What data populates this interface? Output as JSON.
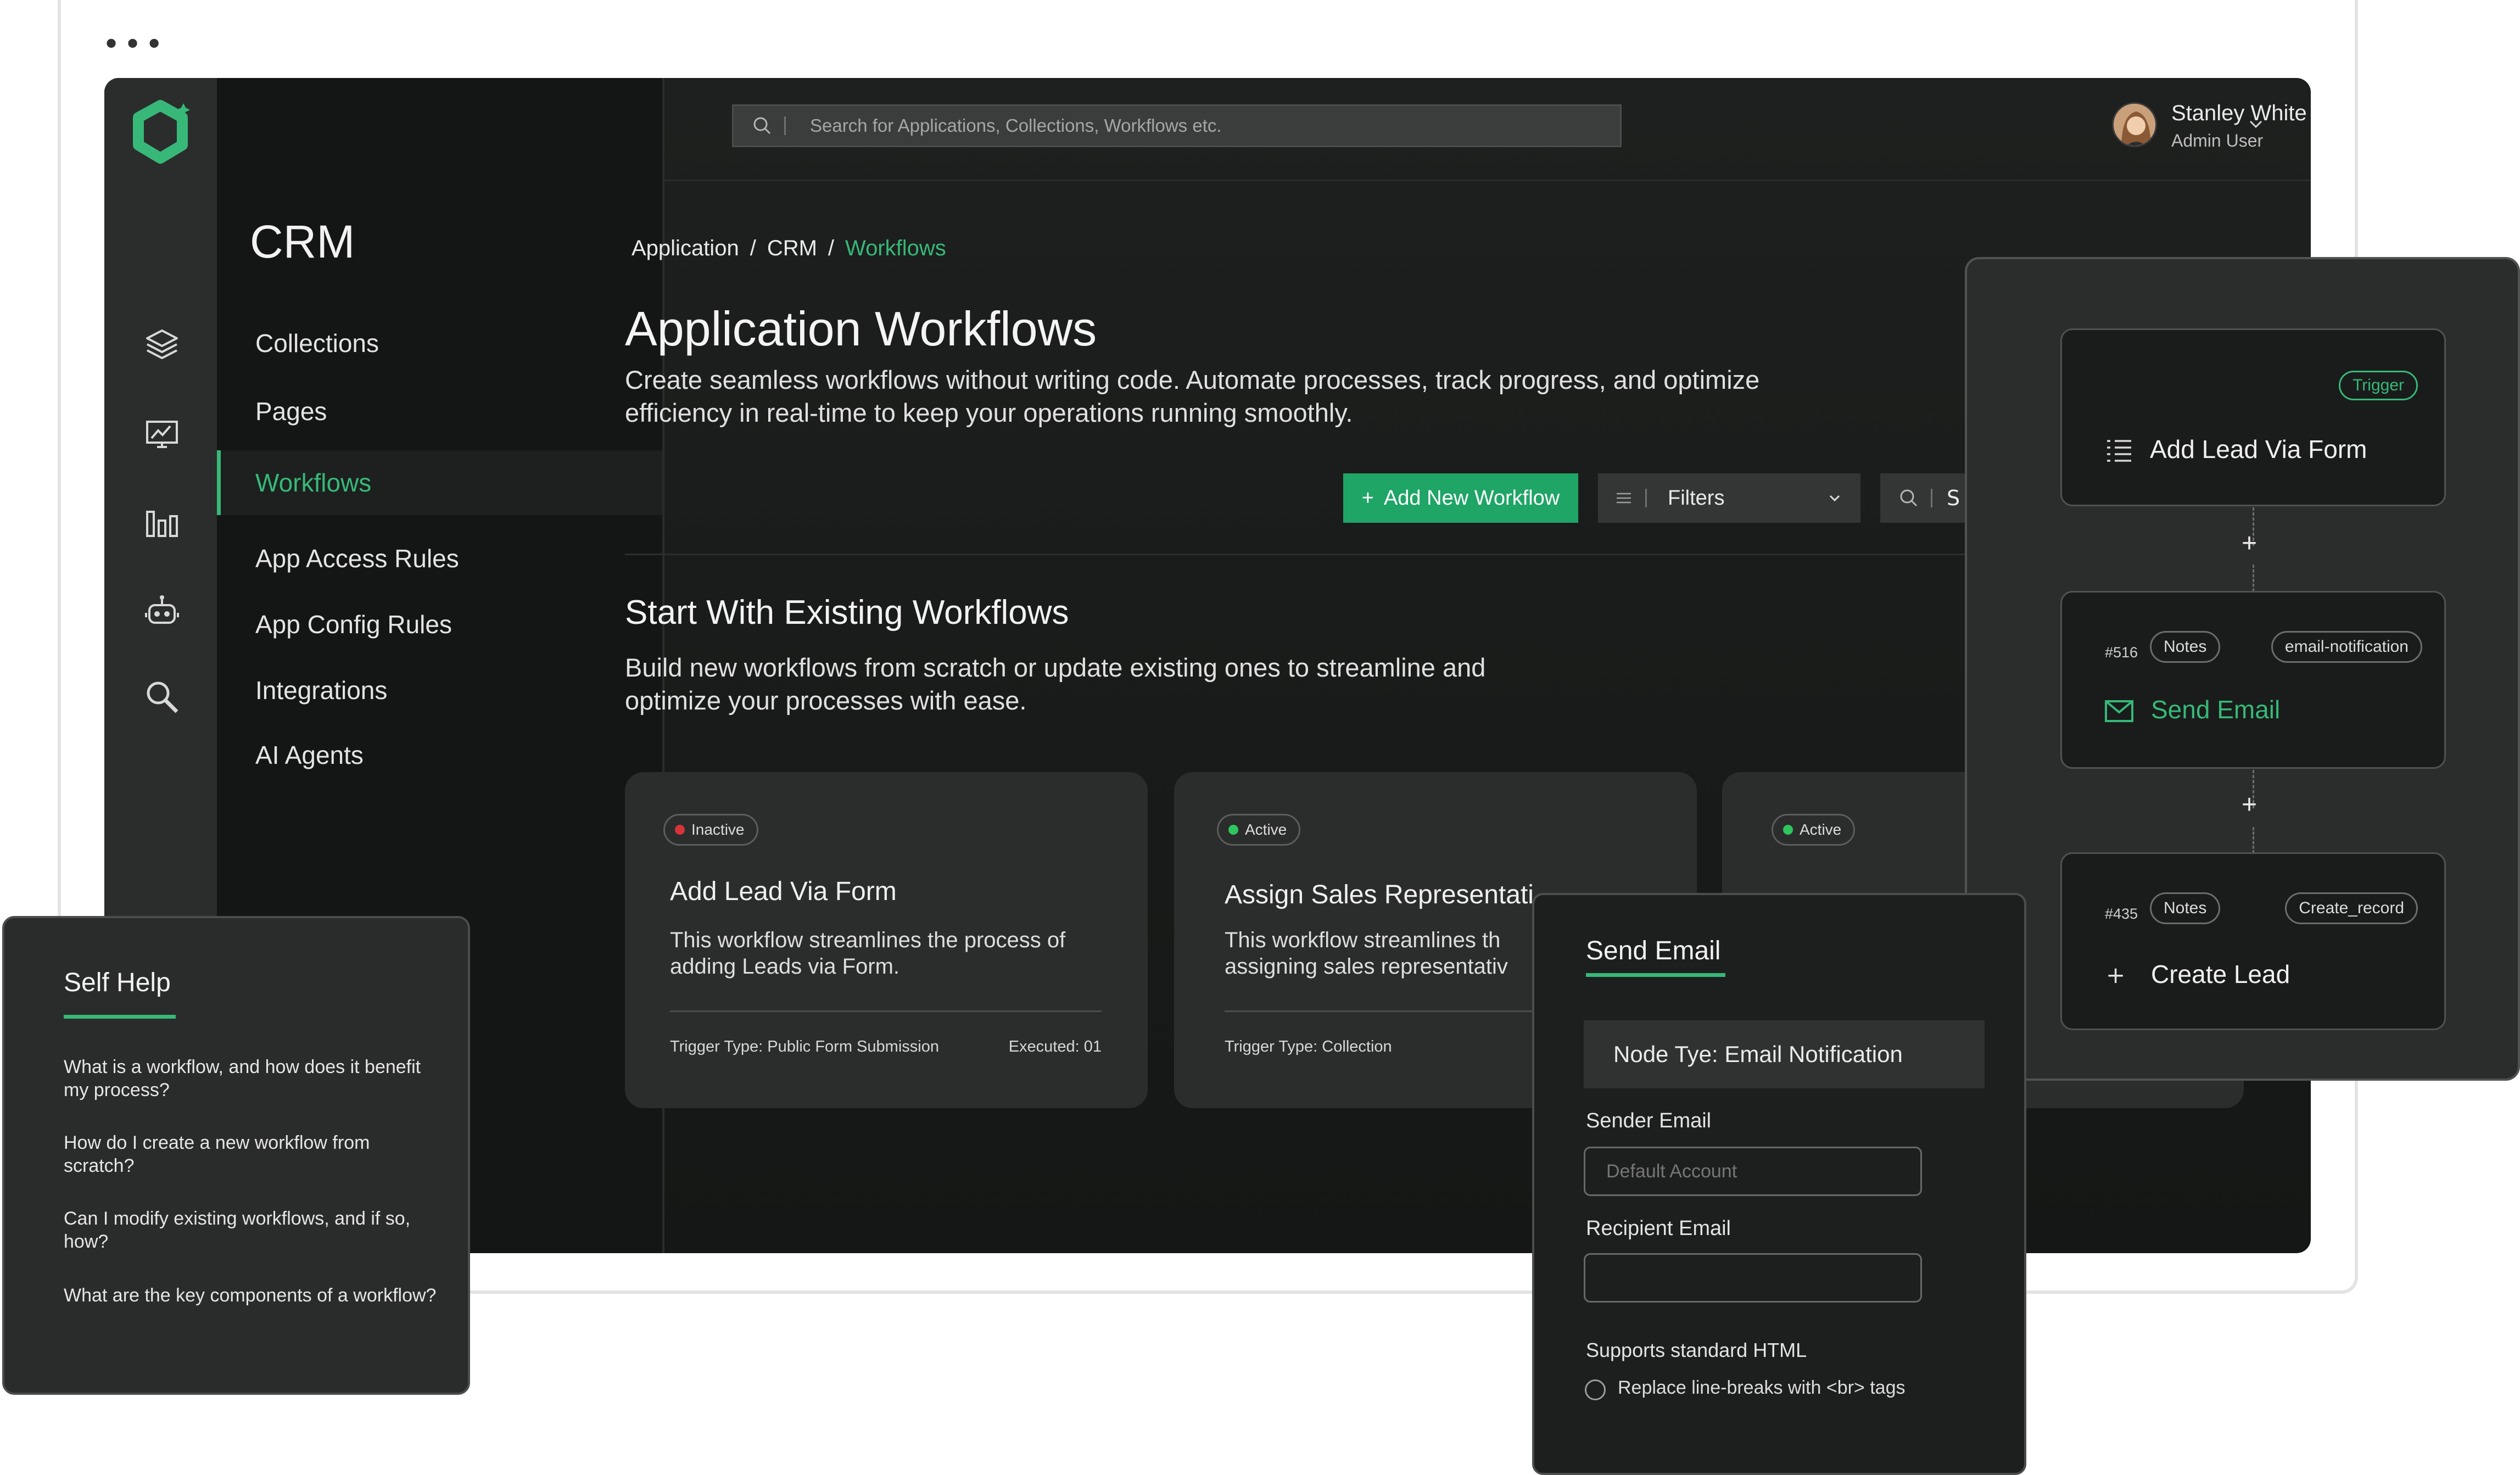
{
  "window": {
    "menu_dots": "•••"
  },
  "sidebar": {
    "app_name": "CRM",
    "items": [
      {
        "label": "Collections"
      },
      {
        "label": "Pages"
      },
      {
        "label": "Workflows",
        "active": true
      },
      {
        "label": "App Access Rules"
      },
      {
        "label": "App Config Rules"
      },
      {
        "label": "Integrations"
      },
      {
        "label": "AI Agents"
      }
    ],
    "rail_icons": [
      "layers-icon",
      "analytics-monitor-icon",
      "bar-chart-icon",
      "robot-icon",
      "search-analysis-icon"
    ]
  },
  "header": {
    "search_placeholder": "Search for Applications, Collections, Workflows etc.",
    "user": {
      "name": "Stanley White",
      "role": "Admin User"
    }
  },
  "breadcrumb": [
    {
      "label": "Application"
    },
    {
      "label": "CRM"
    },
    {
      "label": "Workflows"
    }
  ],
  "breadcrumb_sep": "/",
  "main": {
    "title": "Application Workflows",
    "description": "Create seamless workflows without writing code. Automate processes, track progress, and optimize efficiency in real-time to keep your operations running smoothly.",
    "add_button": "Add New Workflow",
    "add_button_icon": "+",
    "filters_label": "Filters",
    "search_partial": "S",
    "section_title": "Start With Existing Workflows",
    "section_desc": "Build new workflows from scratch or update existing ones to streamline and optimize your processes with ease.",
    "cards": [
      {
        "status": "Inactive",
        "status_color": "#d6343a",
        "title": "Add Lead Via Form",
        "desc": "This workflow streamlines the process of adding Leads via Form.",
        "trigger": "Trigger Type: Public Form Submission",
        "executed": "Executed: 01"
      },
      {
        "status": "Active",
        "status_color": "#2fc55f",
        "title": "Assign Sales Representati",
        "desc": "This workflow streamlines th assigning sales representativ",
        "trigger": "Trigger Type: Collection",
        "executed": ""
      },
      {
        "status": "Active",
        "status_color": "#2fc55f",
        "title": "",
        "desc": "",
        "trigger": "",
        "executed": ""
      }
    ]
  },
  "self_help": {
    "title": "Self Help",
    "questions": [
      "What is a workflow, and how does it benefit my process?",
      "How do I create a new workflow from scratch?",
      "Can I modify existing workflows, and if so, how?",
      "What are the key components of a workflow?"
    ]
  },
  "send_email": {
    "title": "Send Email",
    "node_type": "Node Tye: Email Notification",
    "sender_label": "Sender Email",
    "sender_placeholder": "Default Account",
    "recipient_label": "Recipient Email",
    "recipient_value": "",
    "html_note": "Supports standard HTML",
    "linebreak_option": "Replace line-breaks with <br> tags"
  },
  "flow": {
    "plus": "+",
    "nodes": [
      {
        "tag": "Trigger",
        "title": "Add Lead Via Form",
        "icon": "list-icon"
      },
      {
        "id": "#516",
        "tag1": "Notes",
        "tag2": "email-notification",
        "title": "Send Email",
        "icon": "mail-icon"
      },
      {
        "id": "#435",
        "tag1": "Notes",
        "tag2": "Create_record",
        "title": "Create Lead",
        "icon": "plus-icon",
        "icon_glyph": "+"
      }
    ]
  },
  "colors": {
    "accent": "#37b879",
    "button": "#1fa566",
    "bg": "#161817",
    "panel": "#2b2d2c"
  }
}
